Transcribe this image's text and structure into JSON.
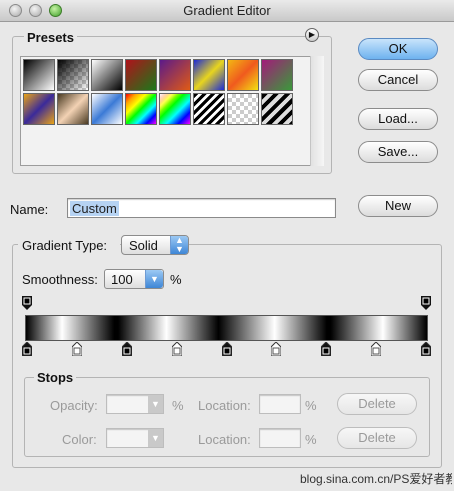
{
  "window": {
    "title": "Gradient Editor"
  },
  "presets": {
    "legend": "Presets",
    "swatches": [
      "linear-gradient(135deg,#000,#fff)",
      "linear-gradient(135deg,#000 0%,rgba(0,0,0,0) 100%),repeating-conic-gradient(#ccc 0 25%,#fff 0 50%) 0 0/8px 8px",
      "linear-gradient(135deg,#fff,#000)",
      "linear-gradient(135deg,#b0121b,#1a7a1a)",
      "linear-gradient(135deg,#5b1a8a,#e05a14)",
      "linear-gradient(135deg,#1b2bd6,#e8d51e,#1b2bd6)",
      "linear-gradient(135deg,#f3b713,#f05a1e,#f3e113)",
      "linear-gradient(135deg,#a31a7a,#3a9a3a)",
      "linear-gradient(135deg,#e9a317,#3a2a9a,#e9a317)",
      "linear-gradient(135deg,#4a3a22,#f3d2b4,#4a3a22)",
      "linear-gradient(135deg,#ffffff,#3b7ad6,#ffffff)",
      "linear-gradient(135deg,red,orange,yellow,lime,cyan,blue,magenta)",
      "linear-gradient(135deg,#fff 0%,rgba(255,255,255,0) 30%),linear-gradient(135deg,red,yellow,lime,cyan,blue,magenta)",
      "repeating-linear-gradient(135deg,#000 0 3px,#fff 3px 6px)",
      "repeating-conic-gradient(#ccc 0 25%,#fff 0 50%) 0 0/8px 8px",
      "repeating-linear-gradient(135deg,#000 0 4px,#ddd 4px 8px)"
    ]
  },
  "buttons": {
    "ok": "OK",
    "cancel": "Cancel",
    "load": "Load...",
    "save": "Save...",
    "new": "New"
  },
  "name": {
    "label": "Name:",
    "value": "Custom"
  },
  "gradient": {
    "type_label": "Gradient Type:",
    "type_value": "Solid",
    "smoothness_label": "Smoothness:",
    "smoothness_value": "100",
    "smoothness_unit": "%"
  },
  "stops": {
    "legend": "Stops",
    "opacity_label": "Opacity:",
    "opacity_unit": "%",
    "location_label": "Location:",
    "location_unit": "%",
    "color_label": "Color:",
    "location2_label": "Location:",
    "location2_unit": "%",
    "delete_label": "Delete",
    "delete2_label": "Delete",
    "count": 9
  },
  "watermark": {
    "text": "blog.sina.com.cn/PS爱好者教程网 www.psahz.com"
  }
}
